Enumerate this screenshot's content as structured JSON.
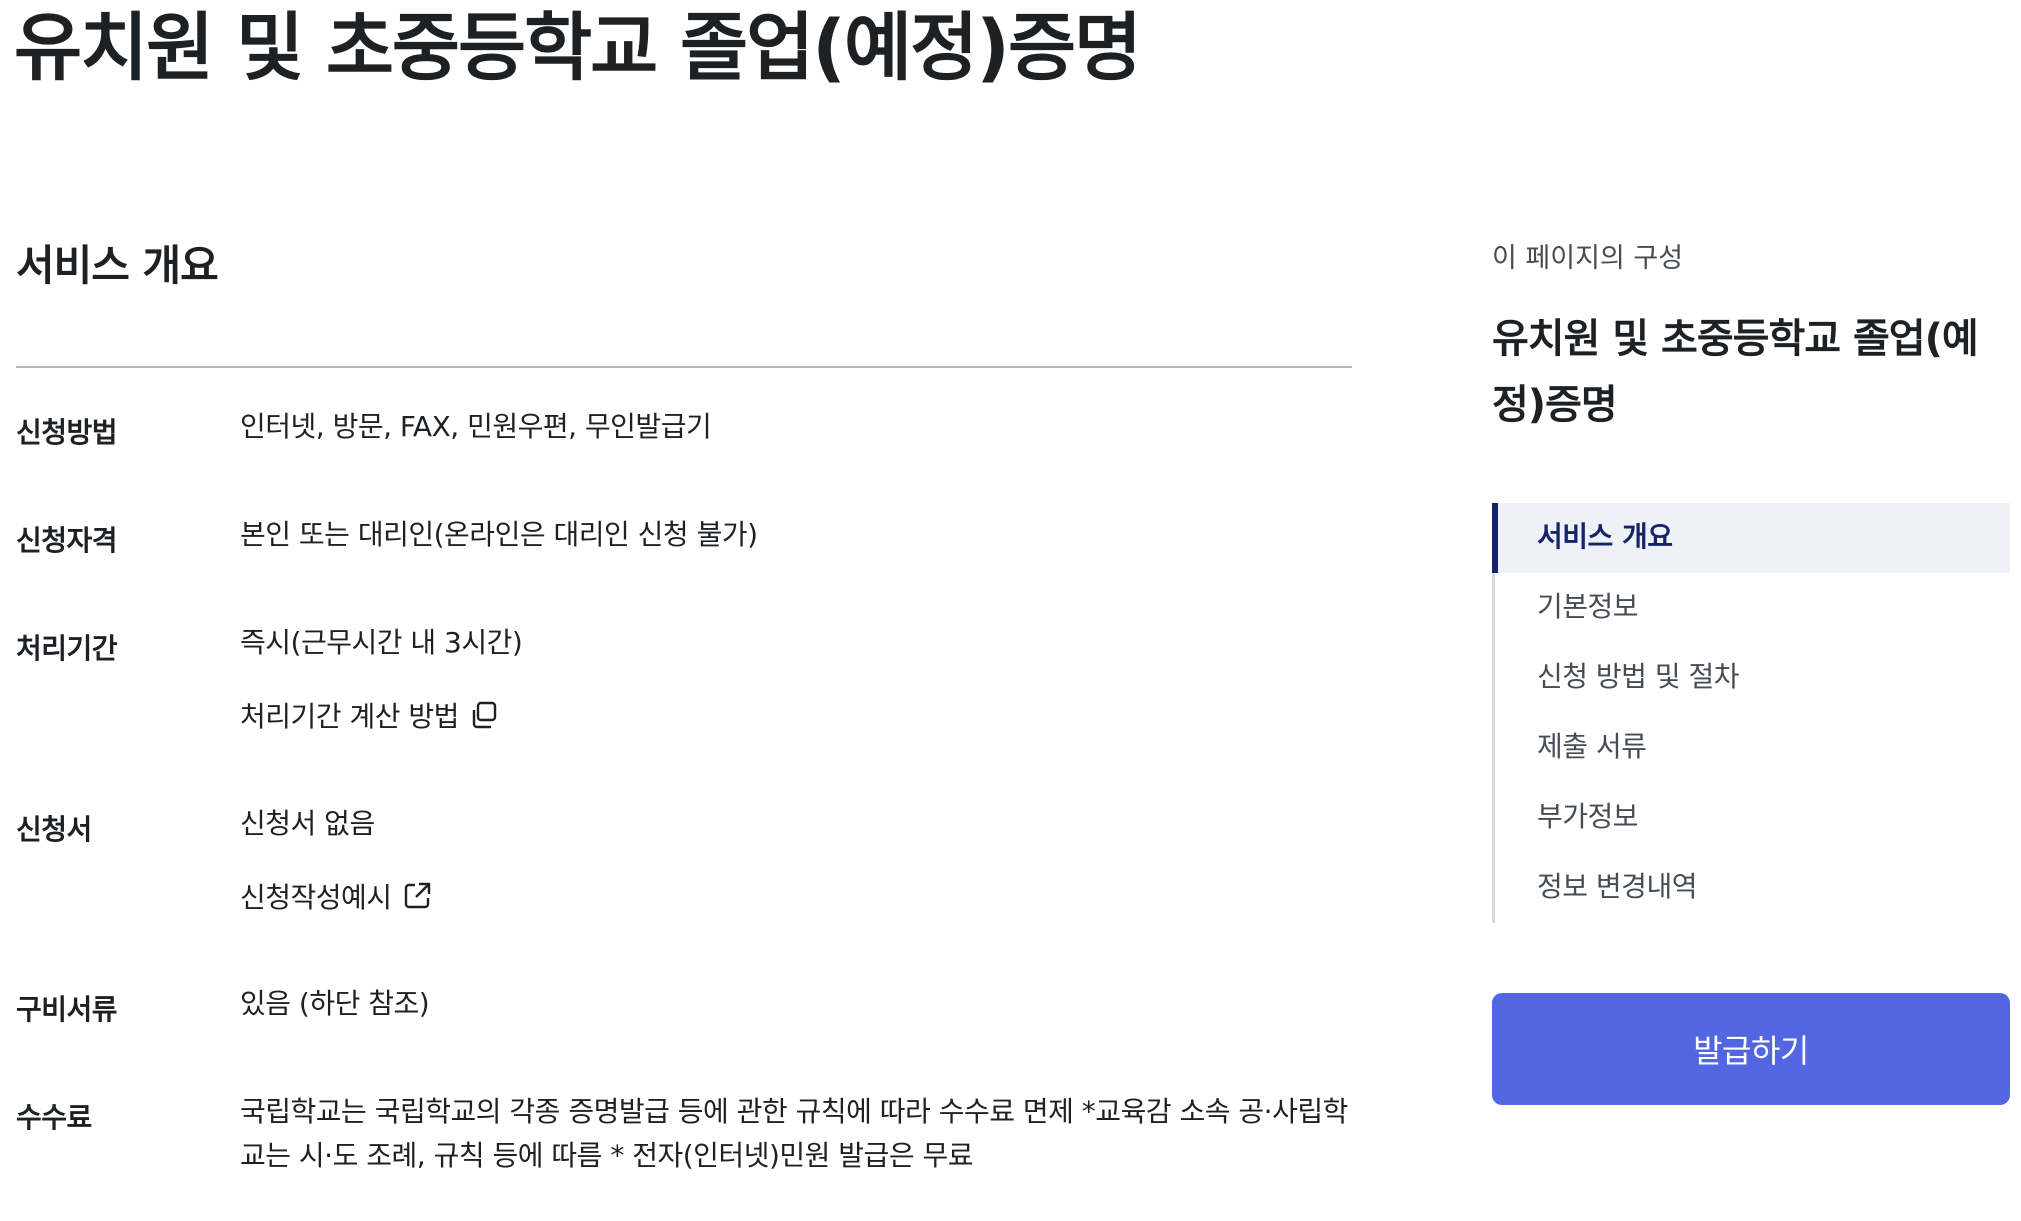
{
  "page": {
    "title": "유치원 및 초중등학교 졸업(예정)증명"
  },
  "overview": {
    "heading": "서비스 개요",
    "rows": [
      {
        "label": "신청방법",
        "value": "인터넷, 방문, FAX, 민원우편, 무인발급기"
      },
      {
        "label": "신청자격",
        "value": "본인 또는 대리인(온라인은 대리인 신청 불가)"
      },
      {
        "label": "처리기간",
        "value": "즉시(근무시간 내 3시간)",
        "link": "처리기간 계산 방법",
        "link_icon": "copy-window-icon"
      },
      {
        "label": "신청서",
        "value": "신청서 없음",
        "link": "신청작성예시",
        "link_icon": "external-link-icon"
      },
      {
        "label": "구비서류",
        "value": "있음 (하단 참조)"
      },
      {
        "label": "수수료",
        "value": "국립학교는 국립학교의 각종 증명발급 등에 관한 규칙에 따라 수수료 면제 *교육감 소속 공·사립학교는 시·도 조례, 규칙 등에 따름 * 전자(인터넷)민원 발급은 무료"
      }
    ]
  },
  "toc": {
    "caption": "이 페이지의 구성",
    "title": "유치원 및 초중등학교 졸업(예정)증명",
    "items": [
      {
        "label": "서비스 개요",
        "active": true
      },
      {
        "label": "기본정보"
      },
      {
        "label": "신청 방법 및 절차"
      },
      {
        "label": "제출 서류"
      },
      {
        "label": "부가정보"
      },
      {
        "label": "정보 변경내역"
      }
    ]
  },
  "actions": {
    "issue_label": "발급하기"
  },
  "colors": {
    "text": "#1e2124",
    "accent_button": "#5366e2",
    "toc_active": "#13246a",
    "toc_active_bg": "#eef2f7",
    "divider": "#b1b8be"
  }
}
